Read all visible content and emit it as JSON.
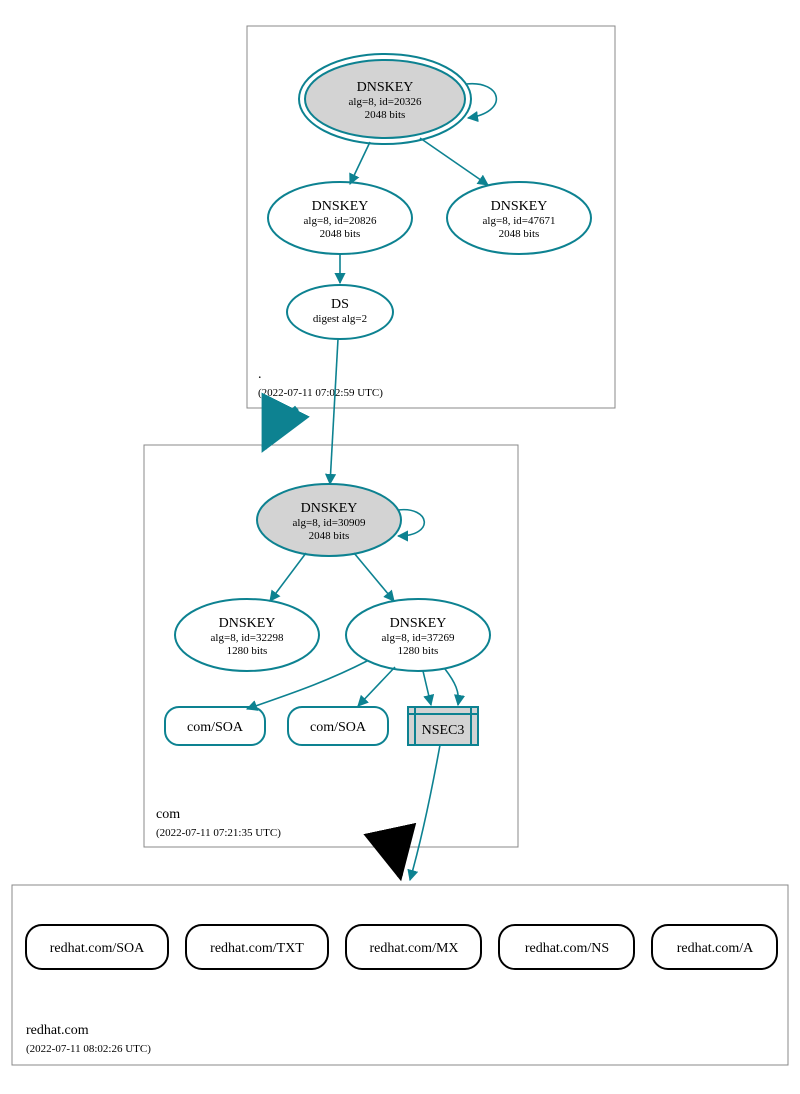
{
  "colors": {
    "teal": "#0d8291",
    "gray_fill": "#d3d3d3",
    "border_gray": "#888888"
  },
  "zones": {
    "root": {
      "label": ".",
      "timestamp": "(2022-07-11 07:02:59 UTC)",
      "nodes": {
        "ksk": {
          "title": "DNSKEY",
          "sub1": "alg=8, id=20326",
          "sub2": "2048 bits"
        },
        "zsk_a": {
          "title": "DNSKEY",
          "sub1": "alg=8, id=20826",
          "sub2": "2048 bits"
        },
        "zsk_b": {
          "title": "DNSKEY",
          "sub1": "alg=8, id=47671",
          "sub2": "2048 bits"
        },
        "ds": {
          "title": "DS",
          "sub1": "digest alg=2"
        }
      }
    },
    "com": {
      "label": "com",
      "timestamp": "(2022-07-11 07:21:35 UTC)",
      "nodes": {
        "ksk": {
          "title": "DNSKEY",
          "sub1": "alg=8, id=30909",
          "sub2": "2048 bits"
        },
        "zsk_a": {
          "title": "DNSKEY",
          "sub1": "alg=8, id=32298",
          "sub2": "1280 bits"
        },
        "zsk_b": {
          "title": "DNSKEY",
          "sub1": "alg=8, id=37269",
          "sub2": "1280 bits"
        },
        "soa_a": {
          "label": "com/SOA"
        },
        "soa_b": {
          "label": "com/SOA"
        },
        "nsec3": {
          "label": "NSEC3"
        }
      }
    },
    "redhat": {
      "label": "redhat.com",
      "timestamp": "(2022-07-11 08:02:26 UTC)",
      "records": {
        "soa": "redhat.com/SOA",
        "txt": "redhat.com/TXT",
        "mx": "redhat.com/MX",
        "ns": "redhat.com/NS",
        "a": "redhat.com/A"
      }
    }
  }
}
